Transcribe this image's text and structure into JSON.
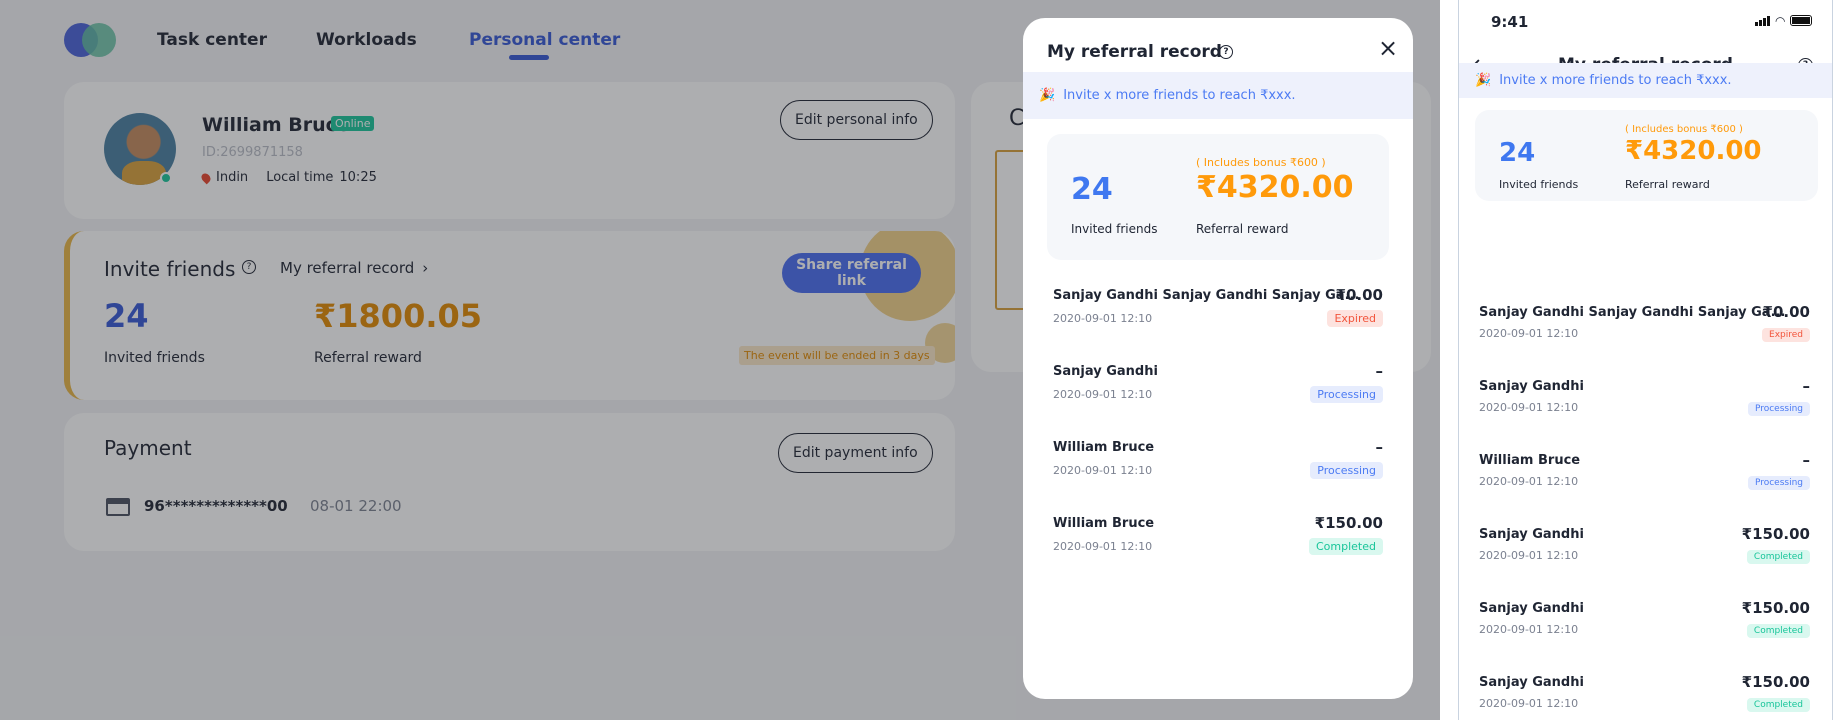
{
  "nav": {
    "items": [
      "Task center",
      "Workloads",
      "Personal center"
    ],
    "active": 2
  },
  "profile": {
    "name": "William Bruce",
    "status": "Online",
    "id": "ID:2699871158",
    "location": "Indin",
    "local_time_label": "Local time",
    "local_time": "10:25",
    "edit_label": "Edit personal info"
  },
  "invite": {
    "title": "Invite friends",
    "record_link": "My referral record",
    "share_label": "Share referral link",
    "invited_count": "24",
    "invited_label": "Invited friends",
    "reward": "₹1800.05",
    "reward_label": "Referral reward",
    "event_notice": "The event will be ended in 3 days"
  },
  "payment": {
    "title": "Payment",
    "edit_label": "Edit payment info",
    "card": "96*************00",
    "date": "08-01 22:00"
  },
  "right_card": {
    "title_partial": "C"
  },
  "modal": {
    "title": "My referral record",
    "banner": "Invite x more friends to reach ₹xxx.",
    "invited_count": "24",
    "invited_label": "Invited friends",
    "bonus": "( Includes bonus ₹600 )",
    "reward": "₹4320.00",
    "reward_label": "Referral reward",
    "records": [
      {
        "name": "Sanjay Gandhi Sanjay Gandhi Sanjay Ga...",
        "date": "2020-09-01 12:10",
        "amount": "₹0.00",
        "status": "Expired"
      },
      {
        "name": "Sanjay Gandhi",
        "date": "2020-09-01 12:10",
        "amount": "–",
        "status": "Processing"
      },
      {
        "name": "William Bruce",
        "date": "2020-09-01 12:10",
        "amount": "–",
        "status": "Processing"
      },
      {
        "name": "William Bruce",
        "date": "2020-09-01 12:10",
        "amount": "₹150.00",
        "status": "Completed"
      }
    ]
  },
  "phone": {
    "time": "9:41",
    "title": "My referral record",
    "banner": "Invite x more friends to reach ₹xxx.",
    "invited_count": "24",
    "invited_label": "Invited friends",
    "bonus": "( Includes bonus ₹600 )",
    "reward": "₹4320.00",
    "reward_label": "Referral reward",
    "records": [
      {
        "name": "Sanjay Gandhi Sanjay Gandhi Sanjay Ga...",
        "date": "2020-09-01 12:10",
        "amount": "₹0.00",
        "status": "Expired"
      },
      {
        "name": "Sanjay Gandhi",
        "date": "2020-09-01 12:10",
        "amount": "–",
        "status": "Processing"
      },
      {
        "name": "William Bruce",
        "date": "2020-09-01 12:10",
        "amount": "–",
        "status": "Processing"
      },
      {
        "name": "Sanjay Gandhi",
        "date": "2020-09-01 12:10",
        "amount": "₹150.00",
        "status": "Completed"
      },
      {
        "name": "Sanjay Gandhi",
        "date": "2020-09-01 12:10",
        "amount": "₹150.00",
        "status": "Completed"
      },
      {
        "name": "Sanjay Gandhi",
        "date": "2020-09-01 12:10",
        "amount": "₹150.00",
        "status": "Completed"
      }
    ]
  },
  "colors": {
    "accent": "#3f78f0",
    "reward": "#ff9a0a",
    "expired": "#f2553c",
    "completed": "#19c59a",
    "online": "#19c59a"
  }
}
